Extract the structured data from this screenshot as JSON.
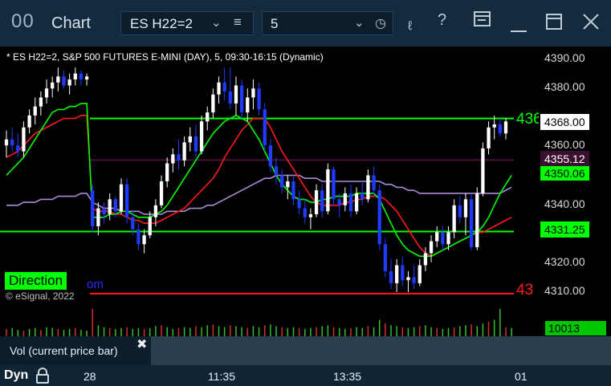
{
  "window": {
    "logo": "00",
    "title": "Chart",
    "symbol": "ES H22=2",
    "interval": "5",
    "icons": [
      "chevron-down-icon",
      "menu-icon",
      "chevron-down-icon",
      "clock-icon",
      "draw-icon",
      "help-icon",
      "panel-icon",
      "minimize-icon",
      "maximize-icon",
      "close-icon"
    ]
  },
  "chart": {
    "title": "* ES H22=2, S&P 500 FUTURES E-MINI (DAY), 5, 09:30-16:15 (Dynamic)",
    "direction_badge": "Direction",
    "direction_tail": "om",
    "copyright": "© eSignal, 2022",
    "right_clip_green": "436",
    "right_clip_red": "43",
    "colors": {
      "background": "#000000",
      "up": "#ffffff",
      "down": "#1f3bff",
      "green_line": "#00ff00",
      "red_line": "#ff1a1a",
      "purple_line": "#a98cd8",
      "maroon_line": "#4a1040"
    }
  },
  "price_axis": {
    "ticks": [
      "4390.00",
      "4380.00",
      "4360.00",
      "4340.00",
      "4320.00",
      "4310.00"
    ],
    "current_price": "4368.00",
    "maroon_level": "4355.12",
    "green_level": "4350.06",
    "green_low_level": "4331.25"
  },
  "volume": {
    "label": "Vol (current price bar)",
    "value": "10013",
    "close": "✖"
  },
  "time_axis": {
    "mode": "Dyn",
    "ticks": [
      "28",
      "11:35",
      "13:35",
      "01"
    ]
  },
  "chart_data": {
    "type": "line",
    "title": "* ES H22=2, S&P 500 FUTURES E-MINI (DAY), 5, 09:30-16:15 (Dynamic)",
    "ylim": [
      4307,
      4393
    ],
    "candle_ohlc": [
      [
        4360,
        4365,
        4356,
        4362
      ],
      [
        4362,
        4366,
        4358,
        4360
      ],
      [
        4360,
        4364,
        4356,
        4358
      ],
      [
        4358,
        4368,
        4356,
        4366
      ],
      [
        4366,
        4372,
        4364,
        4370
      ],
      [
        4370,
        4376,
        4367,
        4373
      ],
      [
        4373,
        4378,
        4370,
        4376
      ],
      [
        4376,
        4382,
        4374,
        4379
      ],
      [
        4379,
        4383,
        4376,
        4381
      ],
      [
        4381,
        4386,
        4378,
        4383
      ],
      [
        4383,
        4385,
        4379,
        4380
      ],
      [
        4380,
        4384,
        4377,
        4382
      ],
      [
        4382,
        4386,
        4380,
        4384
      ],
      [
        4384,
        4385,
        4380,
        4382
      ],
      [
        4382,
        4384,
        4380,
        4383
      ],
      [
        4345,
        4347,
        4331,
        4333
      ],
      [
        4333,
        4341,
        4330,
        4339
      ],
      [
        4339,
        4341,
        4334,
        4337
      ],
      [
        4337,
        4344,
        4335,
        4342
      ],
      [
        4342,
        4343,
        4336,
        4338
      ],
      [
        4338,
        4349,
        4337,
        4347
      ],
      [
        4347,
        4349,
        4334,
        4336
      ],
      [
        4336,
        4338,
        4330,
        4332
      ],
      [
        4332,
        4334,
        4325,
        4327
      ],
      [
        4327,
        4332,
        4324,
        4330
      ],
      [
        4330,
        4338,
        4329,
        4336
      ],
      [
        4336,
        4342,
        4333,
        4340
      ],
      [
        4340,
        4350,
        4339,
        4348
      ],
      [
        4348,
        4356,
        4346,
        4354
      ],
      [
        4354,
        4359,
        4351,
        4357
      ],
      [
        4357,
        4362,
        4352,
        4355
      ],
      [
        4355,
        4363,
        4353,
        4361
      ],
      [
        4361,
        4366,
        4358,
        4363
      ],
      [
        4363,
        4367,
        4356,
        4358
      ],
      [
        4358,
        4370,
        4357,
        4368
      ],
      [
        4368,
        4373,
        4365,
        4371
      ],
      [
        4371,
        4379,
        4369,
        4377
      ],
      [
        4377,
        4383,
        4374,
        4381
      ],
      [
        4381,
        4386,
        4375,
        4378
      ],
      [
        4378,
        4386,
        4372,
        4374
      ],
      [
        4374,
        4383,
        4370,
        4380
      ],
      [
        4380,
        4382,
        4369,
        4371
      ],
      [
        4371,
        4379,
        4368,
        4376
      ],
      [
        4376,
        4382,
        4372,
        4379
      ],
      [
        4379,
        4381,
        4370,
        4372
      ],
      [
        4372,
        4374,
        4358,
        4360
      ],
      [
        4360,
        4362,
        4351,
        4353
      ],
      [
        4353,
        4356,
        4347,
        4350
      ],
      [
        4350,
        4352,
        4344,
        4346
      ],
      [
        4346,
        4350,
        4342,
        4348
      ],
      [
        4348,
        4350,
        4340,
        4342
      ],
      [
        4342,
        4345,
        4337,
        4339
      ],
      [
        4339,
        4342,
        4334,
        4336
      ],
      [
        4336,
        4339,
        4332,
        4337
      ],
      [
        4337,
        4347,
        4336,
        4345
      ],
      [
        4345,
        4347,
        4336,
        4338
      ],
      [
        4338,
        4354,
        4337,
        4352
      ],
      [
        4352,
        4353,
        4340,
        4342
      ],
      [
        4342,
        4344,
        4336,
        4340
      ],
      [
        4340,
        4346,
        4338,
        4344
      ],
      [
        4344,
        4347,
        4336,
        4338
      ],
      [
        4338,
        4346,
        4337,
        4344
      ],
      [
        4344,
        4348,
        4340,
        4342
      ],
      [
        4342,
        4352,
        4341,
        4350
      ],
      [
        4350,
        4353,
        4343,
        4345
      ],
      [
        4345,
        4347,
        4325,
        4327
      ],
      [
        4327,
        4329,
        4316,
        4318
      ],
      [
        4318,
        4322,
        4312,
        4314
      ],
      [
        4314,
        4322,
        4311,
        4320
      ],
      [
        4320,
        4323,
        4313,
        4315
      ],
      [
        4315,
        4318,
        4311,
        4316
      ],
      [
        4316,
        4320,
        4312,
        4314
      ],
      [
        4314,
        4322,
        4313,
        4320
      ],
      [
        4320,
        4326,
        4318,
        4324
      ],
      [
        4324,
        4330,
        4321,
        4328
      ],
      [
        4328,
        4333,
        4326,
        4331
      ],
      [
        4331,
        4333,
        4325,
        4327
      ],
      [
        4327,
        4333,
        4325,
        4331
      ],
      [
        4331,
        4342,
        4329,
        4340
      ],
      [
        4340,
        4343,
        4334,
        4336
      ],
      [
        4336,
        4344,
        4330,
        4342
      ],
      [
        4342,
        4344,
        4325,
        4326
      ],
      [
        4326,
        4346,
        4325,
        4344
      ],
      [
        4344,
        4361,
        4343,
        4359
      ],
      [
        4359,
        4368,
        4357,
        4366
      ],
      [
        4366,
        4370,
        4362,
        4367
      ],
      [
        4367,
        4369,
        4363,
        4364
      ],
      [
        4364,
        4369,
        4362,
        4368
      ]
    ],
    "ma_green_fast": [
      4350,
      4352,
      4354,
      4356,
      4359,
      4362,
      4365,
      4368,
      4371,
      4372,
      4372,
      4373,
      4373,
      4374,
      4374,
      4336,
      4336,
      4336,
      4337,
      4337,
      4338,
      4338,
      4337,
      4336,
      4336,
      4336,
      4337,
      4338,
      4340,
      4343,
      4346,
      4349,
      4352,
      4355,
      4358,
      4361,
      4364,
      4366,
      4368,
      4369,
      4370,
      4369,
      4368,
      4365,
      4362,
      4358,
      4354,
      4350,
      4347,
      4345,
      4343,
      4342,
      4342,
      4341,
      4341,
      4342,
      4342,
      4343,
      4343,
      4343,
      4343,
      4344,
      4344,
      4344,
      4344,
      4342,
      4338,
      4334,
      4330,
      4327,
      4325,
      4324,
      4323,
      4323,
      4323,
      4324,
      4325,
      4326,
      4327,
      4328,
      4329,
      4330,
      4331,
      4333,
      4336,
      4340,
      4344,
      4347,
      4350
    ],
    "ma_red": [
      4356,
      4357,
      4358,
      4360,
      4362,
      4364,
      4365,
      4366,
      4367,
      4368,
      4369,
      4369,
      4369,
      4370,
      4370,
      4339,
      4338,
      4338,
      4338,
      4337,
      4337,
      4336,
      4335,
      4335,
      4334,
      4334,
      4334,
      4335,
      4336,
      4337,
      4338,
      4339,
      4341,
      4343,
      4345,
      4347,
      4349,
      4352,
      4356,
      4359,
      4362,
      4365,
      4367,
      4369,
      4369,
      4369,
      4366,
      4362,
      4358,
      4355,
      4352,
      4349,
      4346,
      4343,
      4341,
      4340,
      4340,
      4340,
      4340,
      4341,
      4341,
      4342,
      4342,
      4343,
      4343,
      4343,
      4342,
      4340,
      4338,
      4335,
      4332,
      4329,
      4326,
      4324,
      4323,
      4324,
      4325,
      4326,
      4327,
      4328,
      4329,
      4330,
      4331,
      4331,
      4332,
      4333,
      4334,
      4335,
      4336
    ],
    "ma_purple": [
      4340,
      4340,
      4340,
      4341,
      4341,
      4341,
      4342,
      4342,
      4342,
      4343,
      4343,
      4343,
      4343,
      4344,
      4344,
      4341,
      4340,
      4339,
      4339,
      4339,
      4338,
      4338,
      4338,
      4338,
      4337,
      4337,
      4337,
      4337,
      4338,
      4338,
      4338,
      4338,
      4339,
      4339,
      4339,
      4340,
      4340,
      4341,
      4342,
      4343,
      4344,
      4345,
      4346,
      4347,
      4348,
      4349,
      4349,
      4350,
      4350,
      4350,
      4350,
      4350,
      4349,
      4349,
      4349,
      4348,
      4348,
      4348,
      4348,
      4348,
      4348,
      4348,
      4348,
      4348,
      4348,
      4348,
      4347,
      4347,
      4346,
      4346,
      4345,
      4345,
      4344,
      4344,
      4344,
      4344,
      4344,
      4344,
      4344,
      4344,
      4344,
      4344,
      4344,
      4344,
      4344,
      4344,
      4344,
      4345,
      4346
    ],
    "levels": {
      "green_upper": 4369,
      "maroon": 4355.12,
      "green_mid": 4350.06,
      "green_lower": 4331.25,
      "red_lower": 4310.5
    },
    "volume": [
      8,
      9,
      7,
      6,
      8,
      9,
      7,
      10,
      9,
      8,
      7,
      8,
      9,
      7,
      6,
      30,
      12,
      10,
      9,
      8,
      9,
      10,
      8,
      9,
      8,
      9,
      11,
      12,
      10,
      8,
      9,
      10,
      9,
      11,
      10,
      12,
      13,
      11,
      10,
      12,
      11,
      10,
      9,
      11,
      10,
      12,
      13,
      11,
      10,
      9,
      10,
      9,
      8,
      9,
      10,
      11,
      12,
      10,
      9,
      8,
      9,
      10,
      9,
      11,
      10,
      18,
      14,
      12,
      11,
      10,
      9,
      10,
      11,
      12,
      10,
      9,
      8,
      9,
      10,
      11,
      12,
      13,
      11,
      14,
      16,
      18,
      30,
      10,
      9
    ]
  }
}
